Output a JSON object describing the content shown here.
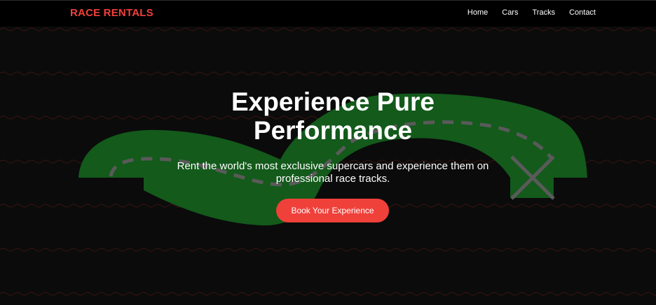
{
  "header": {
    "brand": "RACE RENTALS",
    "nav": [
      {
        "label": "Home"
      },
      {
        "label": "Cars"
      },
      {
        "label": "Tracks"
      },
      {
        "label": "Contact"
      }
    ]
  },
  "hero": {
    "title": "Experience Pure Performance",
    "subtitle": "Rent the world's most exclusive supercars and experience them on professional race tracks.",
    "cta_label": "Book Your Experience"
  },
  "colors": {
    "accent": "#f0403a",
    "background": "#0b0b0b",
    "track_green": "#135a1b",
    "track_dash": "#5a5a5a",
    "wave": "#3a1414"
  },
  "icons": {
    "finish": "finish-cross-icon"
  }
}
